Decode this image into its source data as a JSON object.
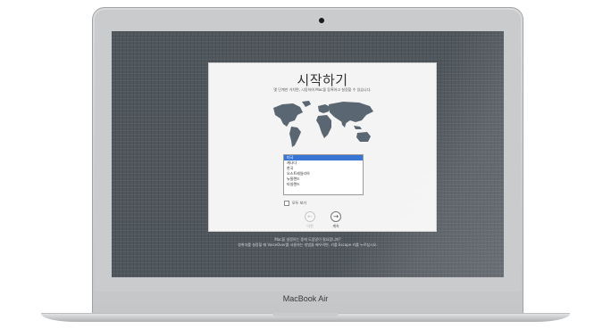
{
  "device": {
    "brand_label": "MacBook Air"
  },
  "setup": {
    "title": "시작하기",
    "subtitle": "몇 단계만 거치면, 시동하여 Mac을 등록하고 설정할 수 있습니다.",
    "country_list": [
      "미국",
      "캐나다",
      "한국",
      "오스트레일리아",
      "뉴질랜드",
      "타일랜드"
    ],
    "selected_index": 0,
    "show_all_label": "모두 보기",
    "back_label": "이전",
    "continue_label": "계속",
    "back_icon": "arrow-left-icon",
    "continue_icon": "arrow-right-icon"
  },
  "hints": {
    "line1": "Mac을 설정하는 중에 도움말이 필요합니까?",
    "line2": "청취자를 설정할 때 VoiceOver를 사용하는 방법을 배우려면, 키를 Escape 키를 누르십시오."
  },
  "colors": {
    "desktop": "#4f565c",
    "selection": "#3876d6",
    "dialog": "#f4f4f4"
  }
}
